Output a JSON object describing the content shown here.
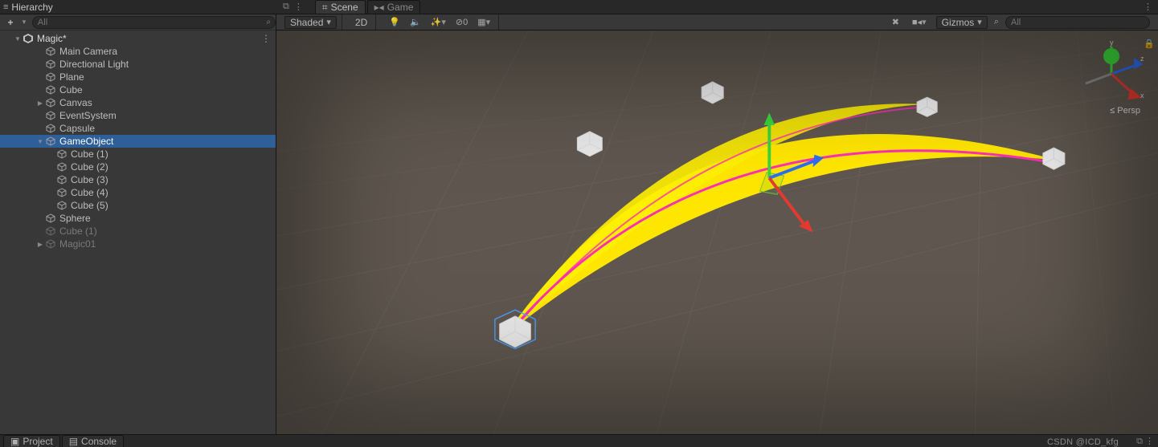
{
  "panels": {
    "hierarchy_title": "Hierarchy",
    "scene_tab": "Scene",
    "game_tab": "Game",
    "project_tab": "Project",
    "console_tab": "Console"
  },
  "hierarchy_search": {
    "placeholder": "All"
  },
  "scene_search": {
    "placeholder": "All"
  },
  "scene_toolbar": {
    "shaded": "Shaded",
    "mode2d": "2D",
    "gizmos": "Gizmos",
    "effects_off": "0"
  },
  "orientation": {
    "x": "x",
    "y": "y",
    "z": "z",
    "mode": "Persp",
    "mode_prefix": "≤"
  },
  "watermark": "CSDN @ICD_kfg",
  "tree": {
    "scene_name": "Magic*",
    "items": [
      {
        "label": "Main Camera",
        "depth": 2
      },
      {
        "label": "Directional Light",
        "depth": 2
      },
      {
        "label": "Plane",
        "depth": 2
      },
      {
        "label": "Cube",
        "depth": 2
      },
      {
        "label": "Canvas",
        "depth": 2,
        "arrow": "right"
      },
      {
        "label": "EventSystem",
        "depth": 2
      },
      {
        "label": "Capsule",
        "depth": 2
      },
      {
        "label": "GameObject",
        "depth": 2,
        "arrow": "down",
        "selected": true
      },
      {
        "label": "Cube (1)",
        "depth": 3
      },
      {
        "label": "Cube (2)",
        "depth": 3
      },
      {
        "label": "Cube (3)",
        "depth": 3
      },
      {
        "label": "Cube (4)",
        "depth": 3
      },
      {
        "label": "Cube (5)",
        "depth": 3
      },
      {
        "label": "Sphere",
        "depth": 2
      },
      {
        "label": "Cube (1)",
        "depth": 2,
        "dim": true
      },
      {
        "label": "Magic01",
        "depth": 2,
        "dim": true,
        "arrow": "right"
      }
    ]
  }
}
